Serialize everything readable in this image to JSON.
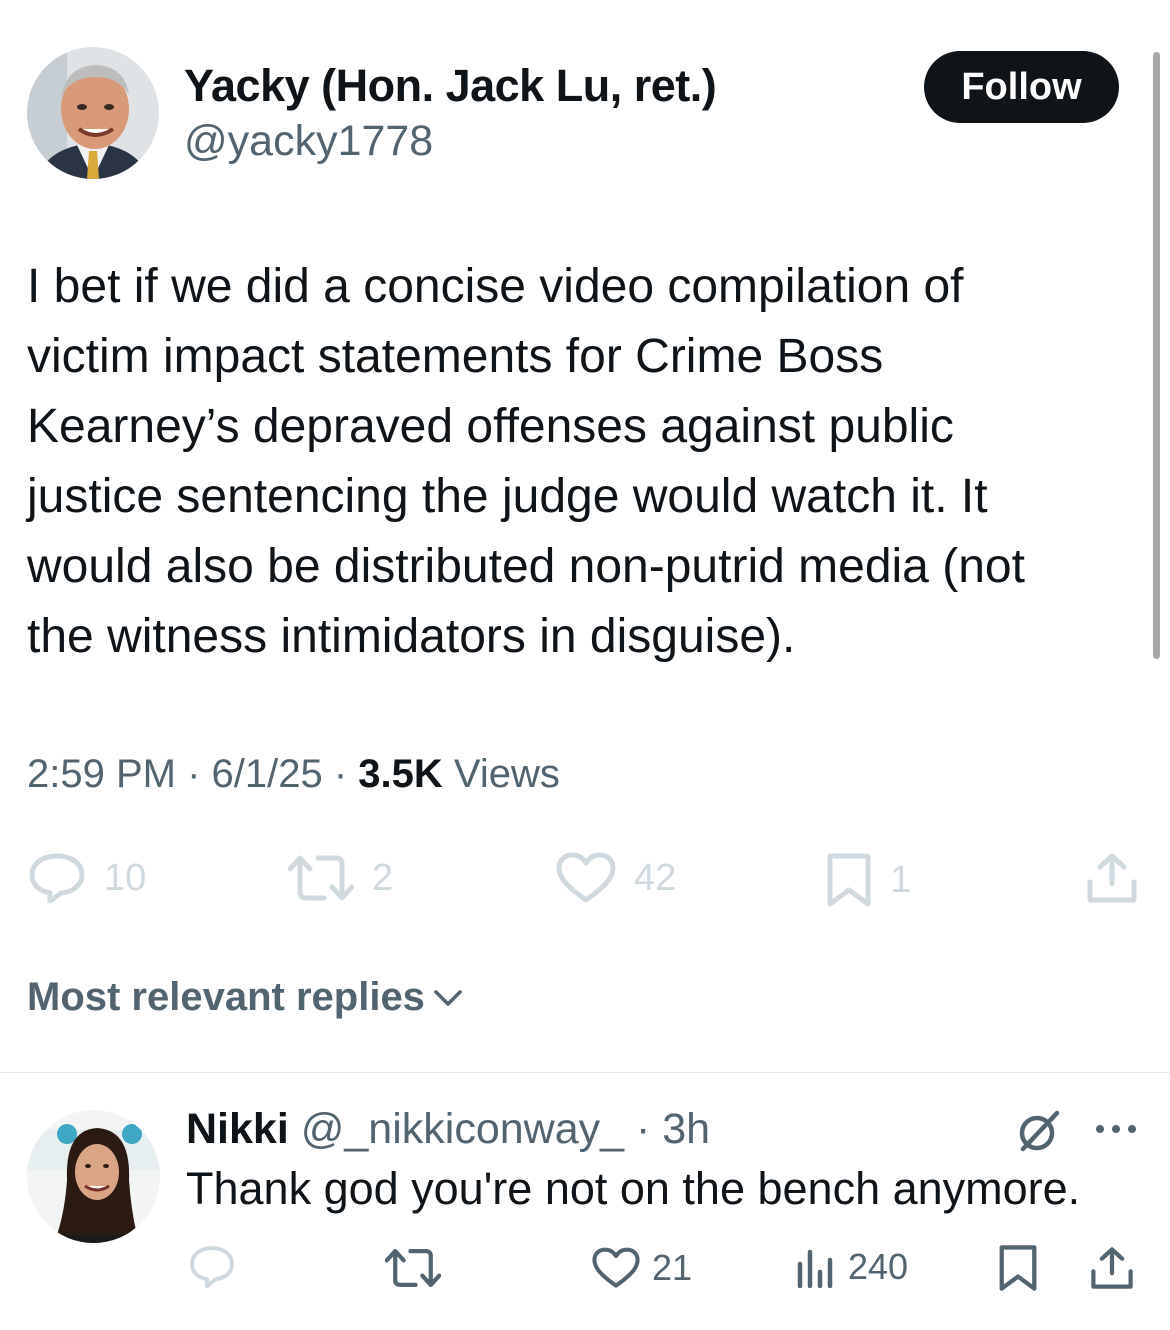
{
  "tweet": {
    "author_name": "Yacky (Hon. Jack Lu, ret.)",
    "author_handle": "@yacky1778",
    "follow_label": "Follow",
    "text": "I bet if we did a concise video compilation of\nvictim impact statements for Crime Boss\nKearney’s depraved offenses against public\njustice sentencing the judge would watch it.  It\nwould also be distributed non-putrid media (not\nthe witness intimidators in disguise).",
    "time": "2:59 PM",
    "date": "6/1/25",
    "views_count": "3.5K",
    "views_label": "Views",
    "replies": "10",
    "reposts": "2",
    "likes": "42",
    "bookmarks": "1"
  },
  "replies_sort": {
    "label": "Most relevant replies"
  },
  "reply": {
    "name": "Nikki",
    "handle": "@_nikkiconway_",
    "age": "3h",
    "text": "Thank god you're not on the bench anymore.",
    "likes": "21",
    "views": "240"
  },
  "icons": {
    "reply": "reply-bubble-icon",
    "repost": "repost-icon",
    "like": "heart-icon",
    "bookmark": "bookmark-icon",
    "share": "share-icon",
    "views": "views-chart-icon",
    "grok": "grok-icon",
    "more": "more-dots-icon",
    "chevron": "chevron-down-icon"
  },
  "colors": {
    "primary_text": "#0f1419",
    "secondary_text": "#536471",
    "disabled_icon": "#cfd9de",
    "follow_button_bg": "#0f1419"
  }
}
